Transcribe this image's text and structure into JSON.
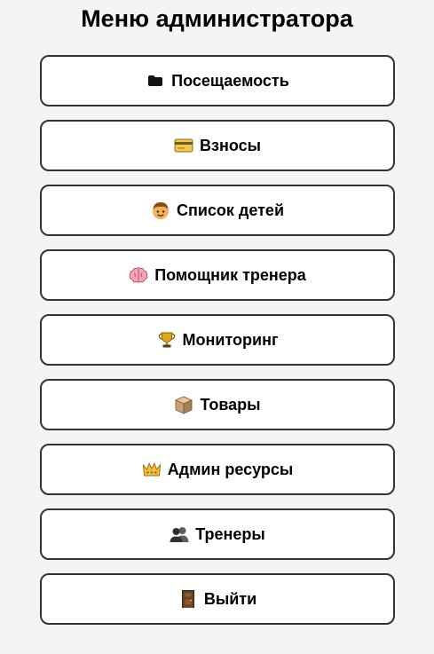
{
  "page": {
    "title": "Меню администратора"
  },
  "menu": {
    "items": [
      {
        "id": "attendance",
        "label": "Посещаемость",
        "icon": "folder-icon"
      },
      {
        "id": "fees",
        "label": "Взносы",
        "icon": "credit-card-icon"
      },
      {
        "id": "children",
        "label": "Список детей",
        "icon": "child-icon"
      },
      {
        "id": "coach-assistant",
        "label": "Помощник тренера",
        "icon": "brain-icon"
      },
      {
        "id": "monitoring",
        "label": "Мониторинг",
        "icon": "trophy-icon"
      },
      {
        "id": "products",
        "label": "Товары",
        "icon": "box-icon"
      },
      {
        "id": "admin-resources",
        "label": "Админ ресурсы",
        "icon": "crown-icon"
      },
      {
        "id": "coaches",
        "label": "Тренеры",
        "icon": "people-icon"
      },
      {
        "id": "logout",
        "label": "Выйти",
        "icon": "door-icon"
      }
    ]
  }
}
